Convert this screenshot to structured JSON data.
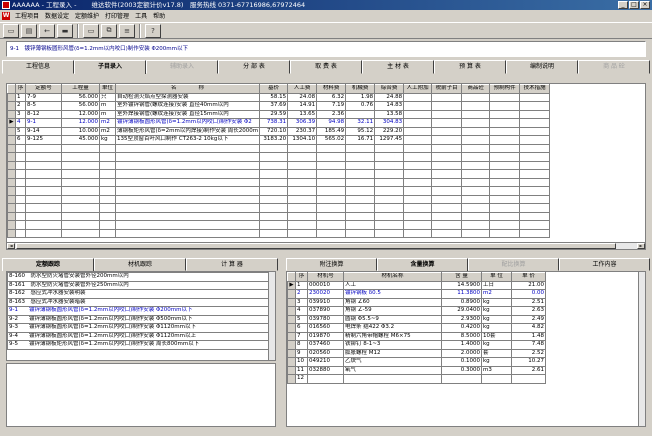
{
  "window": {
    "title": "AAAAAA - 工程录入 - 　　维达软件(2003定额计价v17.8)　服务热线 0371-67716986,67972464"
  },
  "menu": [
    "工程项目",
    "数据设定",
    "定额维护",
    "打印管理",
    "工具",
    "帮助"
  ],
  "description": "9-1　镀锌薄钢板圆形风管(δ=1.2mm以内咬口)制作安装 Φ200mm以下",
  "main_tabs": [
    {
      "label": "工程信息",
      "state": "normal"
    },
    {
      "label": "子目录入",
      "state": "active"
    },
    {
      "label": "辅助录入",
      "state": "disabled"
    },
    {
      "label": "分 部 表",
      "state": "normal"
    },
    {
      "label": "取 费 表",
      "state": "normal"
    },
    {
      "label": "主 材 表",
      "state": "normal"
    },
    {
      "label": "预 算 表",
      "state": "normal"
    },
    {
      "label": "编制说明",
      "state": "normal"
    },
    {
      "label": "商 品 砼",
      "state": "disabled"
    }
  ],
  "main_grid": {
    "headers": [
      "序",
      "定额号",
      "工程量",
      "单位",
      "名　　　　称",
      "基价",
      "人工费",
      "材料费",
      "机械费",
      "综合费",
      "人工附加",
      "税前子目",
      "商品砼",
      "预制构件",
      "技术措施"
    ],
    "rows": [
      [
        "1",
        "7-9",
        "56.000",
        "只",
        "自动检测火焰点型探测器安装",
        "58.15",
        "24.08",
        "6.32",
        "1.98",
        "24.88",
        "",
        "",
        "",
        "",
        ""
      ],
      [
        "2",
        "8-5",
        "56.000",
        "m",
        "室外镀锌钢管(螺纹连接)安装 直径40mm以内",
        "37.69",
        "14.91",
        "7.19",
        "0.76",
        "14.83",
        "",
        "",
        "",
        "",
        ""
      ],
      [
        "3",
        "8-12",
        "12.000",
        "m",
        "室外焊接钢管(螺纹连接)安装 直径15mm以内",
        "29.59",
        "13.65",
        "2.36",
        "",
        "13.58",
        "",
        "",
        "",
        "",
        ""
      ],
      [
        "4",
        "9-1",
        "12.000",
        "m2",
        "镀锌薄钢板圆形风管(δ=1.2mm以内咬口)制作安装 Φ2",
        "738.31",
        "306.39",
        "94.98",
        "32.11",
        "304.83",
        "",
        "",
        "",
        "",
        ""
      ],
      [
        "5",
        "9-14",
        "10.000",
        "m2",
        "薄钢板矩形风管(δ=2mm以内焊接)制作安装 周长2000m",
        "720.10",
        "230.37",
        "185.49",
        "95.12",
        "229.20",
        "",
        "",
        "",
        "",
        ""
      ],
      [
        "6",
        "9-125",
        "45.000",
        "kg",
        "135型顶窗百叶风口制作 CT263-2 10kg以下",
        "3183.20",
        "1304.10",
        "565.02",
        "16.71",
        "1297.45",
        "",
        "",
        "",
        "",
        ""
      ]
    ],
    "selected_row": 3,
    "empty_rows": 11
  },
  "left_tabs": [
    {
      "label": "定额跟踪",
      "state": "active"
    },
    {
      "label": "材机跟踪",
      "state": "normal"
    },
    {
      "label": "计 算 器",
      "state": "normal"
    }
  ],
  "left_list": [
    "8-160　防水型防火堵管安装管外径200mm以内",
    "8-161　防水型防火堵管安装管外径250mm以内",
    "8-162　感应式冲水器安装明装",
    "8-163　感应式冲水器安装暗装",
    "9-1　　镀锌薄钢板圆形风管(δ=1.2mm以内咬口)制作安装 Φ200mm以下",
    "9-2　　镀锌薄钢板圆形风管(δ=1.2mm以内咬口)制作安装 Φ500mm以下",
    "9-3　　镀锌薄钢板圆形风管(δ=1.2mm以内咬口)制作安装 Φ1120mm以下",
    "9-4　　镀锌薄钢板圆形风管(δ=1.2mm以内咬口)制作安装 Φ1120mm以上",
    "9-5　　镀锌薄钢板矩形风管(δ=1.2mm以内咬口)制作安装 周长800mm以下"
  ],
  "right_tabs": [
    {
      "label": "附注换算",
      "state": "normal"
    },
    {
      "label": "含量换算",
      "state": "active"
    },
    {
      "label": "配比换算",
      "state": "disabled"
    },
    {
      "label": "工作内容",
      "state": "normal"
    }
  ],
  "right_grid": {
    "headers": [
      "序",
      "材机号",
      "材机名称",
      "含 量",
      "单 位",
      "单 价"
    ],
    "rows": [
      [
        "1",
        "000010",
        "人工",
        "14.5900",
        "工日",
        "21.00"
      ],
      [
        "2",
        "230020",
        "镀锌钢板 δ0.5",
        "11.3800",
        "m2",
        "0.00"
      ],
      [
        "3",
        "039910",
        "角钢 ∠60",
        "0.8900",
        "kg",
        "2.51"
      ],
      [
        "4",
        "037890",
        "角钢 ∠-59",
        "29.0400",
        "kg",
        "2.63"
      ],
      [
        "5",
        "039780",
        "圆钢 Φ5.5~9",
        "2.9300",
        "kg",
        "2.49"
      ],
      [
        "6",
        "016560",
        "电焊条 结422 Φ3.2",
        "0.4200",
        "kg",
        "4.82"
      ],
      [
        "7",
        "019870",
        "精制六角带帽螺栓 M6×75",
        "8.5000",
        "10套",
        "1.48"
      ],
      [
        "8",
        "037460",
        "铁铆钉 8-1~3",
        "1.4000",
        "kg",
        "7.48"
      ],
      [
        "9",
        "020560",
        "膨胀螺栓 M12",
        "2.0000",
        "套",
        "2.52"
      ],
      [
        "10",
        "049210",
        "乙炔气",
        "0.1000",
        "kg",
        "10.27"
      ],
      [
        "11",
        "032880",
        "氧气",
        "0.3000",
        "m3",
        "2.61"
      ],
      [
        "12",
        "",
        "",
        "",
        "",
        ""
      ]
    ],
    "selected_row": 1
  }
}
